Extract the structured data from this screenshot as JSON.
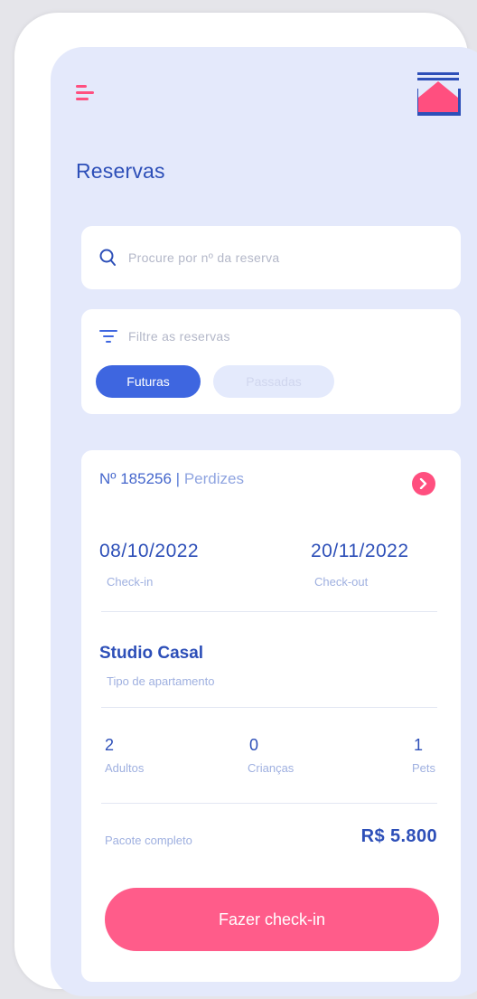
{
  "header": {
    "title": "Reservas",
    "menu_icon": "menu-icon",
    "home_icon": "home-icon"
  },
  "search": {
    "placeholder": "Procure por nº da reserva",
    "icon": "search-icon"
  },
  "filter": {
    "label": "Filtre as reservas",
    "icon": "filter-icon",
    "chips": [
      {
        "label": "Futuras",
        "active": true
      },
      {
        "label": "Passadas",
        "active": false
      }
    ]
  },
  "reservation": {
    "number": "Nº 185256",
    "separator": "|",
    "location": "Perdizes",
    "checkin_date": "08/10/2022",
    "checkin_label": "Check-in",
    "checkout_date": "20/11/2022",
    "checkout_label": "Check-out",
    "apartment": "Studio Casal",
    "apartment_label": "Tipo de apartamento",
    "counts": [
      {
        "value": "2",
        "label": "Adultos"
      },
      {
        "value": "0",
        "label": "Crianças"
      },
      {
        "value": "1",
        "label": "Pets"
      }
    ],
    "package_label": "Pacote completo",
    "price": "R$ 5.800",
    "action_label": "Fazer check-in"
  },
  "colors": {
    "accent_pink": "#ff5c8a",
    "primary_blue": "#2d4fb8",
    "chip_blue": "#3e66e0",
    "screen_bg": "#e4e9fb"
  }
}
